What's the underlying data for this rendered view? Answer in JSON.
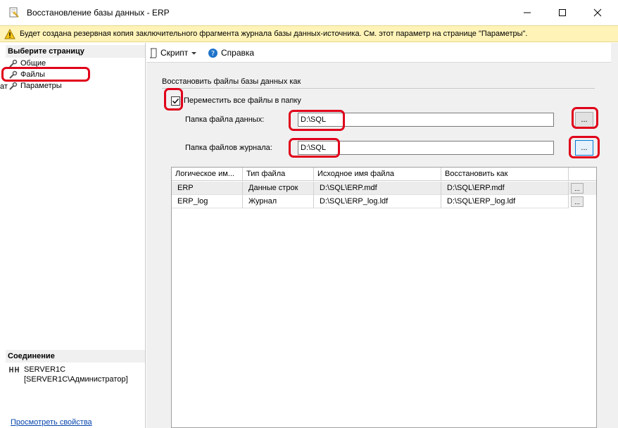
{
  "window": {
    "title": "Восстановление базы данных - ERP",
    "controls": [
      "minimize",
      "maximize",
      "close"
    ]
  },
  "warning": {
    "icon": "warning-icon",
    "text": "Будет создана резервная копия заключительного фрагмента журнала базы данных-источника. См. этот параметр на странице \"Параметры\"."
  },
  "sidebar": {
    "header": "Выберите страницу",
    "items": [
      {
        "label": "Общие",
        "icon": "wrench-icon"
      },
      {
        "label": "Файлы",
        "icon": "wrench-icon",
        "selected": true
      },
      {
        "label": "Параметры",
        "icon": "wrench-icon"
      }
    ],
    "stray_text": "ат",
    "connection": {
      "header": "Соединение",
      "server": "SERVER1C",
      "user": "[SERVER1C\\Администратор]",
      "icon": "connection-icon"
    },
    "link": "Просмотреть свойства"
  },
  "toolbar": {
    "script_label": "Скрипт",
    "help_label": "Справка"
  },
  "form": {
    "group_title": "Восстановить файлы базы данных как",
    "relocate_label": "Переместить все файлы в папку",
    "relocate_checked": true,
    "data_folder_label": "Папка файла данных:",
    "data_folder_value": "D:\\SQL",
    "log_folder_label": "Папка файлов журнала:",
    "log_folder_value": "D:\\SQL",
    "browse_label": "..."
  },
  "files_table": {
    "columns": [
      "Логическое им...",
      "Тип файла",
      "Исходное имя файла",
      "Восстановить как",
      ""
    ],
    "rows": [
      {
        "logical": "ERP",
        "type": "Данные строк",
        "original": "D:\\SQL\\ERP.mdf",
        "restore_as": "D:\\SQL\\ERP.mdf",
        "btn": "..."
      },
      {
        "logical": "ERP_log",
        "type": "Журнал",
        "original": "D:\\SQL\\ERP_log.ldf",
        "restore_as": "D:\\SQL\\ERP_log.ldf",
        "btn": "..."
      }
    ]
  },
  "colors": {
    "annotation": "#e0001a",
    "warning_bg": "#fff3b8",
    "panel_bg": "#f0f0f0",
    "link": "#0645ad",
    "focus": "#0078d7"
  }
}
